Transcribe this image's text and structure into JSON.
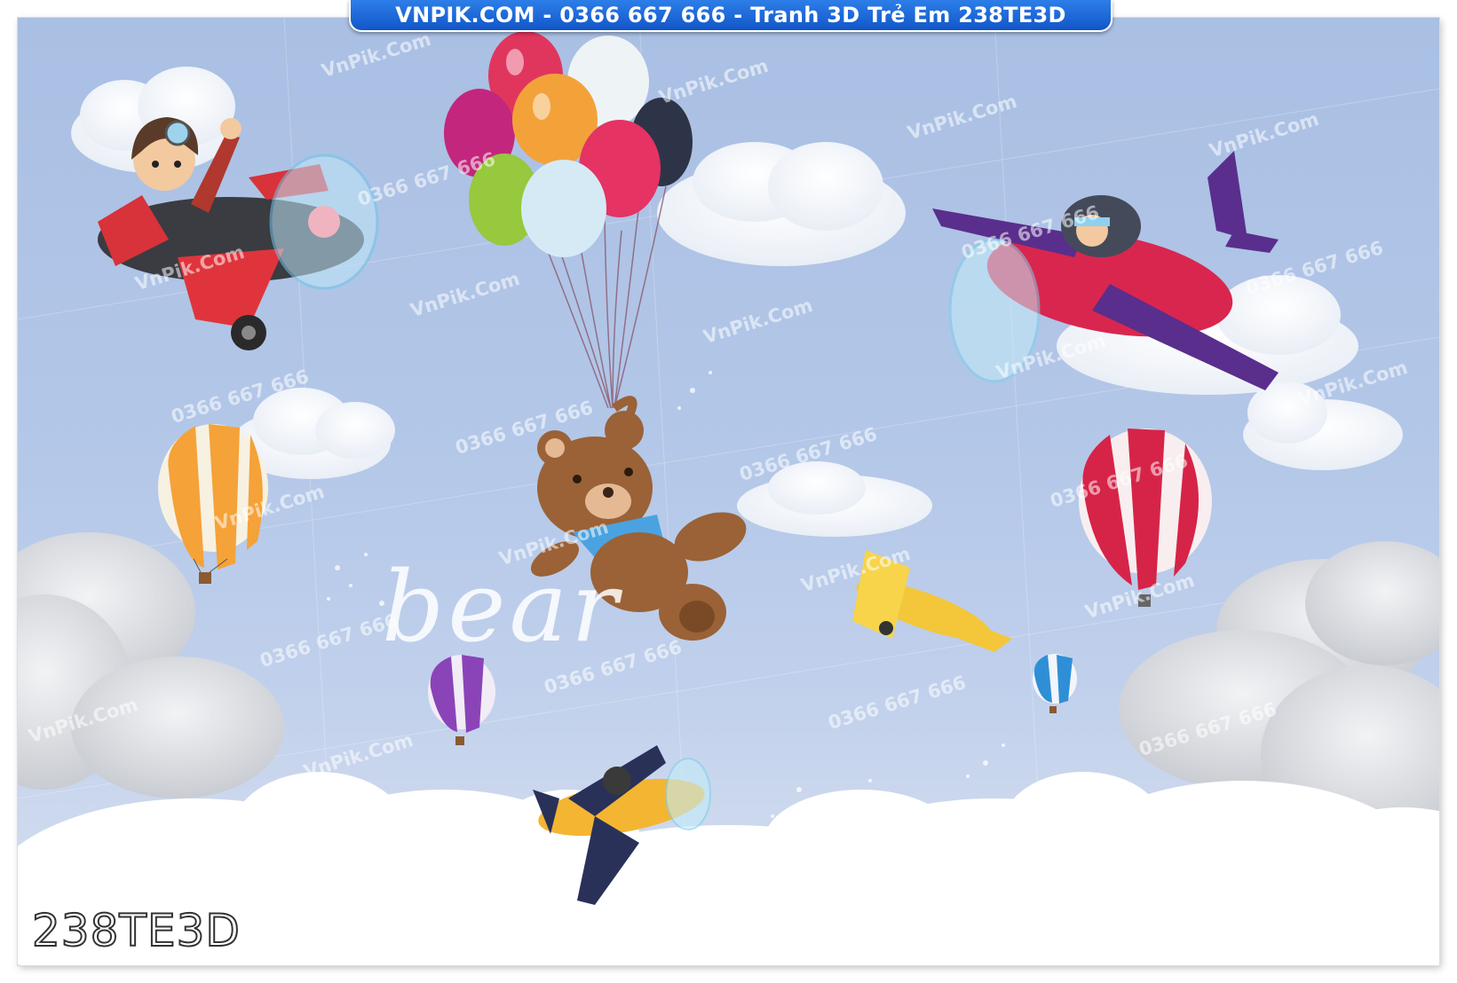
{
  "banner": {
    "text": "VNPIK.COM - 0366 667 666 - Tranh 3D Trẻ Em 238TE3D"
  },
  "artwork": {
    "word": "bear",
    "product_code": "238TE3D"
  },
  "watermarks": {
    "site": "VnPik.Com",
    "phone": "0366 667 666"
  },
  "colors": {
    "banner_blue": "#1a66d9",
    "sky": "#b0c4e6",
    "cloud": "#ffffff"
  }
}
